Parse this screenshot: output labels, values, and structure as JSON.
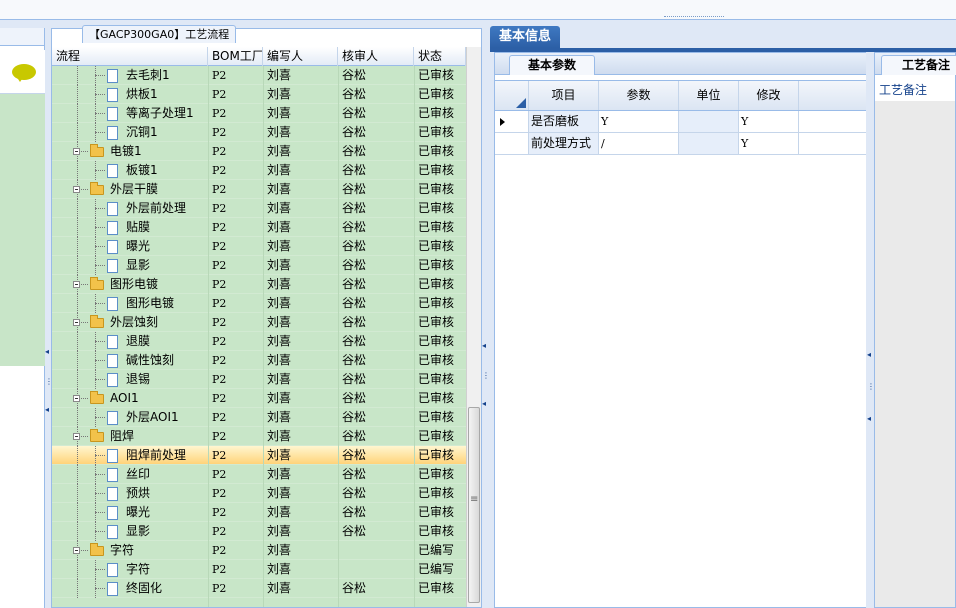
{
  "process_panel": {
    "tab_title": "【GACP300GA0】工艺流程",
    "columns": [
      "流程",
      "BOM工厂",
      "编写人",
      "核审人",
      "状态"
    ],
    "rows": [
      {
        "name": "去毛刺1",
        "level": 2,
        "type": "doc",
        "bom": "P2",
        "writer": "刘喜",
        "reviewer": "谷松",
        "status": "已审核",
        "selected": false
      },
      {
        "name": "烘板1",
        "level": 2,
        "type": "doc",
        "bom": "P2",
        "writer": "刘喜",
        "reviewer": "谷松",
        "status": "已审核",
        "selected": false
      },
      {
        "name": "等离子处理1",
        "level": 2,
        "type": "doc",
        "bom": "P2",
        "writer": "刘喜",
        "reviewer": "谷松",
        "status": "已审核",
        "selected": false
      },
      {
        "name": "沉铜1",
        "level": 2,
        "type": "doc",
        "bom": "P2",
        "writer": "刘喜",
        "reviewer": "谷松",
        "status": "已审核",
        "selected": false
      },
      {
        "name": "电镀1",
        "level": 1,
        "type": "folder",
        "bom": "P2",
        "writer": "刘喜",
        "reviewer": "谷松",
        "status": "已审核",
        "selected": false
      },
      {
        "name": "板镀1",
        "level": 2,
        "type": "doc",
        "bom": "P2",
        "writer": "刘喜",
        "reviewer": "谷松",
        "status": "已审核",
        "selected": false
      },
      {
        "name": "外层干膜",
        "level": 1,
        "type": "folder",
        "bom": "P2",
        "writer": "刘喜",
        "reviewer": "谷松",
        "status": "已审核",
        "selected": false
      },
      {
        "name": "外层前处理",
        "level": 2,
        "type": "doc",
        "bom": "P2",
        "writer": "刘喜",
        "reviewer": "谷松",
        "status": "已审核",
        "selected": false
      },
      {
        "name": "贴膜",
        "level": 2,
        "type": "doc",
        "bom": "P2",
        "writer": "刘喜",
        "reviewer": "谷松",
        "status": "已审核",
        "selected": false
      },
      {
        "name": "曝光",
        "level": 2,
        "type": "doc",
        "bom": "P2",
        "writer": "刘喜",
        "reviewer": "谷松",
        "status": "已审核",
        "selected": false
      },
      {
        "name": "显影",
        "level": 2,
        "type": "doc",
        "bom": "P2",
        "writer": "刘喜",
        "reviewer": "谷松",
        "status": "已审核",
        "selected": false
      },
      {
        "name": "图形电镀",
        "level": 1,
        "type": "folder",
        "bom": "P2",
        "writer": "刘喜",
        "reviewer": "谷松",
        "status": "已审核",
        "selected": false
      },
      {
        "name": "图形电镀",
        "level": 2,
        "type": "doc",
        "bom": "P2",
        "writer": "刘喜",
        "reviewer": "谷松",
        "status": "已审核",
        "selected": false
      },
      {
        "name": "外层蚀刻",
        "level": 1,
        "type": "folder",
        "bom": "P2",
        "writer": "刘喜",
        "reviewer": "谷松",
        "status": "已审核",
        "selected": false
      },
      {
        "name": "退膜",
        "level": 2,
        "type": "doc",
        "bom": "P2",
        "writer": "刘喜",
        "reviewer": "谷松",
        "status": "已审核",
        "selected": false
      },
      {
        "name": "碱性蚀刻",
        "level": 2,
        "type": "doc",
        "bom": "P2",
        "writer": "刘喜",
        "reviewer": "谷松",
        "status": "已审核",
        "selected": false
      },
      {
        "name": "退锡",
        "level": 2,
        "type": "doc",
        "bom": "P2",
        "writer": "刘喜",
        "reviewer": "谷松",
        "status": "已审核",
        "selected": false
      },
      {
        "name": "AOI1",
        "level": 1,
        "type": "folder",
        "bom": "P2",
        "writer": "刘喜",
        "reviewer": "谷松",
        "status": "已审核",
        "selected": false
      },
      {
        "name": "外层AOI1",
        "level": 2,
        "type": "doc",
        "bom": "P2",
        "writer": "刘喜",
        "reviewer": "谷松",
        "status": "已审核",
        "selected": false
      },
      {
        "name": "阻焊",
        "level": 1,
        "type": "folder",
        "bom": "P2",
        "writer": "刘喜",
        "reviewer": "谷松",
        "status": "已审核",
        "selected": false
      },
      {
        "name": "阻焊前处理",
        "level": 2,
        "type": "doc",
        "bom": "P2",
        "writer": "刘喜",
        "reviewer": "谷松",
        "status": "已审核",
        "selected": true
      },
      {
        "name": "丝印",
        "level": 2,
        "type": "doc",
        "bom": "P2",
        "writer": "刘喜",
        "reviewer": "谷松",
        "status": "已审核",
        "selected": false
      },
      {
        "name": "预烘",
        "level": 2,
        "type": "doc",
        "bom": "P2",
        "writer": "刘喜",
        "reviewer": "谷松",
        "status": "已审核",
        "selected": false
      },
      {
        "name": "曝光",
        "level": 2,
        "type": "doc",
        "bom": "P2",
        "writer": "刘喜",
        "reviewer": "谷松",
        "status": "已审核",
        "selected": false
      },
      {
        "name": "显影",
        "level": 2,
        "type": "doc",
        "bom": "P2",
        "writer": "刘喜",
        "reviewer": "谷松",
        "status": "已审核",
        "selected": false
      },
      {
        "name": "字符",
        "level": 1,
        "type": "folder",
        "bom": "P2",
        "writer": "刘喜",
        "reviewer": "",
        "status": "已编写",
        "selected": false
      },
      {
        "name": "字符",
        "level": 2,
        "type": "doc",
        "bom": "P2",
        "writer": "刘喜",
        "reviewer": "",
        "status": "已编写",
        "selected": false
      },
      {
        "name": "终固化",
        "level": 2,
        "type": "doc",
        "bom": "P2",
        "writer": "刘喜",
        "reviewer": "谷松",
        "status": "已审核",
        "selected": false
      }
    ]
  },
  "info_panel": {
    "main_tab": "基本信息",
    "sub_tab": "基本参数",
    "columns": [
      "项目",
      "参数",
      "单位",
      "修改"
    ],
    "rows": [
      {
        "item": "是否磨板",
        "param": "Y",
        "unit": "",
        "modify": "Y",
        "current": true
      },
      {
        "item": "前处理方式",
        "param": "/",
        "unit": "",
        "modify": "Y",
        "current": false
      }
    ]
  },
  "notes_panel": {
    "tab": "工艺备注",
    "label": "工艺备注"
  }
}
